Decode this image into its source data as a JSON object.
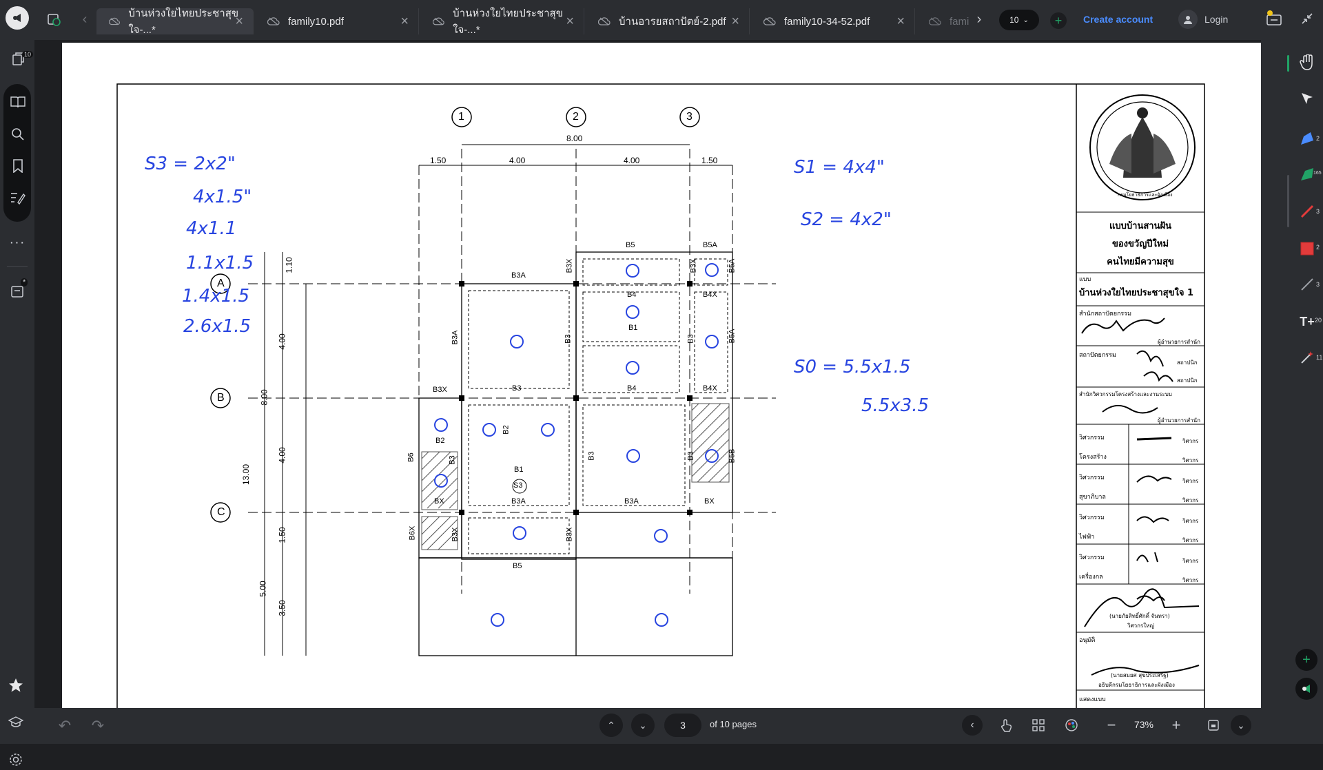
{
  "tabs": [
    {
      "label": "บ้านห่วงใยไทยประชาสุขใจ-...*",
      "active": true
    },
    {
      "label": "family10.pdf",
      "active": false
    },
    {
      "label": "บ้านห่วงใยไทยประชาสุขใจ-...*",
      "active": false
    },
    {
      "label": "บ้านอารยสถาปัตย์-2.pdf",
      "active": false
    },
    {
      "label": "family10-34-52.pdf",
      "active": false
    },
    {
      "label": "fami",
      "active": false
    }
  ],
  "topbar": {
    "tab_count": "10",
    "create_account": "Create account",
    "login": "Login"
  },
  "leftbar": {
    "pages_badge": "10",
    "new_badge": "*"
  },
  "rightbar": {
    "counts": [
      "2",
      "165",
      "3",
      "2",
      "3",
      "20",
      "11"
    ]
  },
  "bottombar": {
    "page_number": "3",
    "page_total": "of 10 pages",
    "zoom": "73%"
  },
  "drawing": {
    "grid_columns": [
      "1",
      "2",
      "3"
    ],
    "grid_rows": [
      "A",
      "B",
      "C"
    ],
    "top_dims": [
      "8.00",
      "1.50",
      "4.00",
      "4.00",
      "1.50"
    ],
    "left_dims": [
      "1.10",
      "4.00",
      "8.00",
      "4.00",
      "13.00",
      "1.50",
      "5.00",
      "3.50"
    ],
    "beams": [
      "B5",
      "B5A",
      "B3A",
      "B3X",
      "B3X",
      "B5A",
      "B4",
      "B4X",
      "B1",
      "B3A",
      "B3",
      "B3",
      "B5A",
      "B3X",
      "B3",
      "B4",
      "B4X",
      "B2",
      "B1",
      "B3",
      "B3",
      "B6",
      "BX",
      "B3A",
      "B3A",
      "BX",
      "B5B",
      "B6X",
      "B3X",
      "B3X",
      "B5",
      "B2",
      "B3"
    ],
    "slab_label": "S3"
  },
  "notes": {
    "left": [
      "S3 = 2x2\"",
      "4x1.5\"",
      "4x1.1",
      "1.1x1.5",
      "1.4x1.5",
      "2.6x1.5"
    ],
    "right_s1": "S1 = 4x4\"",
    "right_s2": "S2 = 4x2\"",
    "right_s0a": "S0 = 5.5x1.5",
    "right_s0b": "5.5x3.5"
  },
  "title_block": {
    "project_line1": "แบบบ้านสานฝัน",
    "project_line2": "ของขวัญปีใหม่",
    "project_line3": "คนไทยมีความสุข",
    "plan_label": "แบบ",
    "plan_name": "บ้านห่วงใยไทยประชาสุขใจ 1",
    "office": "สำนักสถาปัตยกรรม",
    "office_role": "ผู้อำนวยการสำนัก",
    "architect": "สถาปัตยกรรม",
    "architect_role1": "สถาปนิก",
    "architect_role2": "สถาปนิก",
    "eng_office": "สำนักวิศวกรรมโครงสร้างและงานระบบ",
    "eng_office_role": "ผู้อำนวยการสำนัก",
    "rows": [
      {
        "label": "วิศวกรรม",
        "role": "วิศวกร"
      },
      {
        "label": "โครงสร้าง",
        "role": "วิศวกร"
      },
      {
        "label": "วิศวกรรม",
        "role": "วิศวกร"
      },
      {
        "label": "สุขาภิบาล",
        "role": "วิศวกร"
      },
      {
        "label": "วิศวกรรม",
        "role": "วิศวกร"
      },
      {
        "label": "ไฟฟ้า",
        "role": "วิศวกร"
      },
      {
        "label": "วิศวกรรม",
        "role": "วิศวกร"
      },
      {
        "label": "เครื่องกล",
        "role": "วิศวกร"
      }
    ],
    "chief_name": "(นายภัยสิทธิ์ศักดิ์ จันทรา)",
    "chief_role": "วิศวกรใหญ่",
    "approve": "อนุมัติ",
    "director_name": "(นายสมยศ สุขประเสริฐ)",
    "director_role": "อธิบดีกรมโยธาธิการและผังเมือง",
    "sheet_label": "แสดงแบบ",
    "seal_text": "กรมโยธาธิการและผังเมือง"
  },
  "colors": {
    "accent": "#4a8cff",
    "ink": "#2845e0",
    "green": "#21a366",
    "red": "#e23b3b"
  }
}
